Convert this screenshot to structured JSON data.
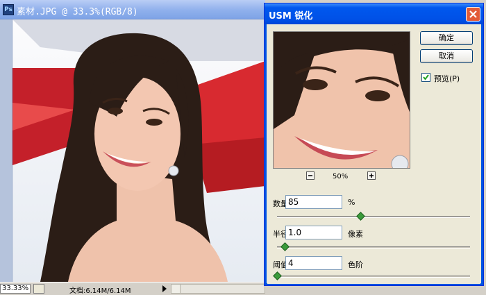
{
  "document": {
    "title": "素材.JPG @ 33.3%(RGB/8)",
    "zoom": "33.33%",
    "doc_info": "文档:6.14M/6.14M"
  },
  "dialog": {
    "title": "USM 锐化",
    "buttons": {
      "ok": "确定",
      "cancel": "取消"
    },
    "preview": {
      "label": "预览(P)",
      "checked": true
    },
    "preview_zoom": "50%",
    "amount": {
      "label": "数量(A):",
      "value": "85",
      "unit": "%",
      "fraction": 0.43
    },
    "radius": {
      "label": "半径(R):",
      "value": "1.0",
      "unit": "像素",
      "fraction": 0.04
    },
    "threshold": {
      "label": "阈值(T):",
      "value": "4",
      "unit": "色阶",
      "fraction": 0.0
    }
  },
  "icons": [
    "photoshop-app-icon",
    "close-icon",
    "zoom-out-icon",
    "zoom-in-icon",
    "checkbox-checked-icon",
    "status-arrow-icon"
  ]
}
